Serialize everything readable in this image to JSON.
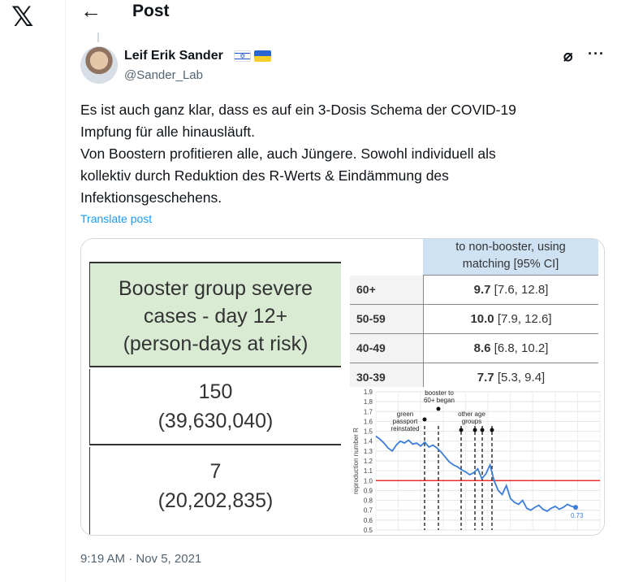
{
  "app": {
    "logo": "𝕏"
  },
  "header": {
    "title": "Post",
    "back_icon": "←"
  },
  "author": {
    "name": "Leif Erik Sander",
    "handle": "@Sander_Lab"
  },
  "icons": {
    "grok": "⌀",
    "more": "···"
  },
  "post": {
    "lines": [
      "Es ist auch ganz klar, dass es auf ein 3-Dosis Schema der COVID-19",
      "Impfung für alle hinausläuft.",
      "Von Boostern profitieren alle, auch Jüngere. Sowohl individuell als",
      "kollektiv durch Reduktion des R-Werts & Eindämmung des",
      "Infektionsgeschehens."
    ],
    "translate_label": "Translate post",
    "timestamp": "9:19 AM · Nov 5, 2021"
  },
  "media": {
    "left_table": {
      "header_lines": [
        "Booster group severe",
        "cases - day 12+",
        "(person-days at risk)"
      ],
      "rows": [
        {
          "count": "150",
          "persondays": "(39,630,040)"
        },
        {
          "count": "7",
          "persondays": "(20,202,835)"
        }
      ]
    },
    "right_table": {
      "header_lines": [
        "to non-booster, using",
        "matching [95% CI]"
      ],
      "rows": [
        {
          "age": "60+",
          "value": "9.7",
          "ci": "[7.6, 12.8]"
        },
        {
          "age": "50-59",
          "value": "10.0",
          "ci": "[7.9, 12.6]"
        },
        {
          "age": "40-49",
          "value": "8.6",
          "ci": "[6.8, 10.2]"
        },
        {
          "age": "30-39",
          "value": "7.7",
          "ci": "[5.3, 9.4]"
        }
      ]
    }
  },
  "chart_data": {
    "type": "line",
    "ylabel": "reproduction number R",
    "ylim": [
      0.5,
      1.9
    ],
    "yticks": [
      "0.5",
      "0.6",
      "0.7",
      "0.8",
      "0.9",
      "1.0",
      "1.1",
      "1.2",
      "1.3",
      "1.4",
      "1.5",
      "1.6",
      "1.7",
      "1.8",
      "1.9"
    ],
    "reference_line": 1.0,
    "end_label": "0.73",
    "annotations": [
      {
        "text": [
          "green",
          "passport",
          "reinstated"
        ]
      },
      {
        "text": [
          "booster to",
          "60+ began"
        ]
      },
      {
        "text": [
          "other age",
          "groups"
        ]
      }
    ],
    "series": [
      {
        "values": [
          1.45,
          1.42,
          1.38,
          1.33,
          1.3,
          1.36,
          1.4,
          1.38,
          1.41,
          1.37,
          1.38,
          1.35,
          1.39,
          1.34,
          1.36,
          1.33,
          1.29,
          1.24,
          1.19,
          1.16,
          1.14,
          1.11,
          1.09,
          1.06,
          1.08,
          1.12,
          1.02,
          1.07,
          1.16,
          1.0,
          0.9,
          0.86,
          0.95,
          0.82,
          0.78,
          0.76,
          0.8,
          0.72,
          0.7,
          0.73,
          0.75,
          0.71,
          0.69,
          0.72,
          0.74,
          0.71,
          0.73,
          0.76,
          0.74,
          0.73
        ]
      }
    ],
    "colors": {
      "line": "#3b7dd8",
      "reference": "#e8302c"
    }
  }
}
